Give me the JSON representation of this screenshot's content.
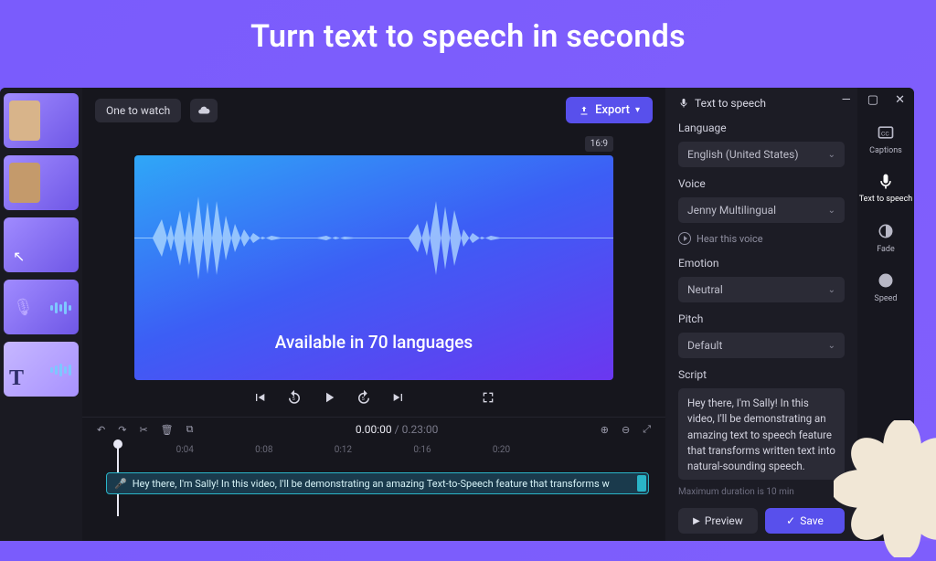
{
  "hero": {
    "title": "Turn text to speech in seconds"
  },
  "toolbar": {
    "project_name": "One to watch",
    "export_label": "Export",
    "aspect_ratio": "16:9"
  },
  "preview": {
    "overlay_text": "Available in 70 languages"
  },
  "playback": {
    "time_current": "0.00:00",
    "time_total": "0.23:00"
  },
  "ruler": [
    "",
    "0:04",
    "0:08",
    "0:12",
    "0:16",
    "0:20",
    ""
  ],
  "clip": {
    "text": "Hey there, I'm Sally! In this video, I'll be demonstrating an amazing Text-to-Speech feature that transforms w"
  },
  "panel": {
    "heading": "Text to speech",
    "language_label": "Language",
    "language_value": "English (United States)",
    "voice_label": "Voice",
    "voice_value": "Jenny Multilingual",
    "hear_label": "Hear this voice",
    "emotion_label": "Emotion",
    "emotion_value": "Neutral",
    "pitch_label": "Pitch",
    "pitch_value": "Default",
    "script_label": "Script",
    "script_value": "Hey there, I'm Sally! In this video, I'll be demonstrating an amazing text to speech feature that transforms written text into natural-sounding speech.",
    "max_note": "Maximum duration is 10 min",
    "preview_btn": "Preview",
    "save_btn": "Save"
  },
  "rail": {
    "captions": "Captions",
    "tts": "Text to speech",
    "fade": "Fade",
    "speed": "Speed"
  }
}
